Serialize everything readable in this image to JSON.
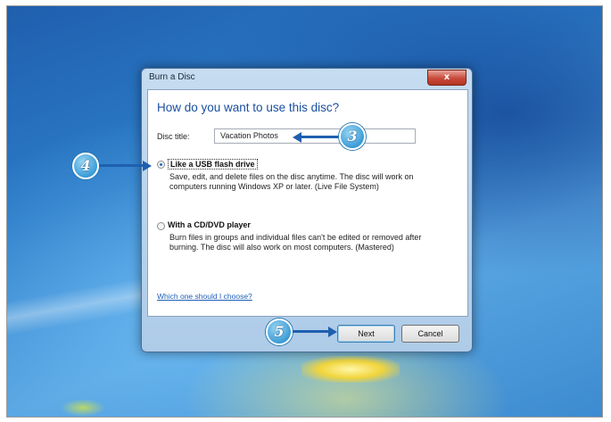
{
  "dialog": {
    "title": "Burn a Disc",
    "close_glyph": "x",
    "heading": "How do you want to use this disc?",
    "disc_title_label": "Disc title:",
    "disc_title_value": "Vacation Photos",
    "options": [
      {
        "title": "Like a USB flash drive",
        "description": "Save, edit, and delete files on the disc anytime. The disc will work on computers running Windows XP or later. (Live File System)",
        "selected": true
      },
      {
        "title": "With a CD/DVD player",
        "description": "Burn files in groups and individual files can't be edited or removed after burning. The disc will also work on most computers. (Mastered)",
        "selected": false
      }
    ],
    "help_link": "Which one should I choose?",
    "next_label": "Next",
    "cancel_label": "Cancel"
  },
  "callouts": {
    "step3": "3",
    "step4": "4",
    "step5": "5",
    "color": "#3a9bd6"
  }
}
